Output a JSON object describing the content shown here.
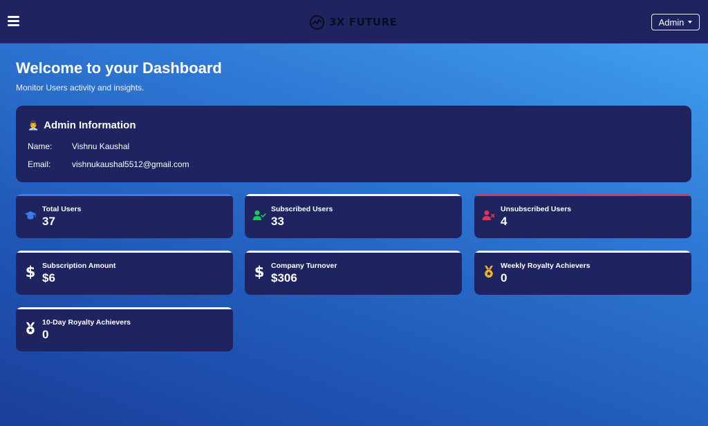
{
  "navbar": {
    "brand": "3X FUTURE",
    "admin_label": "Admin"
  },
  "header": {
    "title": "Welcome to your Dashboard",
    "subtitle": "Monitor Users activity and insights."
  },
  "admin_info": {
    "title": "Admin Information",
    "icon": "person-icon",
    "name_label": "Name:",
    "name_value": "Vishnu Kaushal",
    "email_label": "Email:",
    "email_value": "vishnukaushal5512@gmail.com"
  },
  "stats": [
    {
      "label": "Total Users",
      "value": "37",
      "icon": "graduation-cap-icon",
      "accent": "#3d7bf0",
      "icon_color": "#3d7bf0"
    },
    {
      "label": "Subscribed Users",
      "value": "33",
      "icon": "user-check-icon",
      "accent": "#ffffff",
      "icon_color": "#21c55d"
    },
    {
      "label": "Unsubscribed Users",
      "value": "4",
      "icon": "user-x-icon",
      "accent": "#e0344f",
      "icon_color": "#e0344f"
    },
    {
      "label": "Subscription Amount",
      "value": "$6",
      "icon": "dollar-icon",
      "accent": "#ffffff",
      "icon_color": "#ffffff"
    },
    {
      "label": "Company Turnover",
      "value": "$306",
      "icon": "dollar-icon",
      "accent": "#ffffff",
      "icon_color": "#ffffff"
    },
    {
      "label": "Weekly Royalty Achievers",
      "value": "0",
      "icon": "medal-icon",
      "accent": "#ffffff",
      "icon_color": "#f0b429"
    },
    {
      "label": "10-Day Royalty Achievers",
      "value": "0",
      "icon": "medal-icon",
      "accent": "#ffffff",
      "icon_color": "#ffffff"
    }
  ]
}
